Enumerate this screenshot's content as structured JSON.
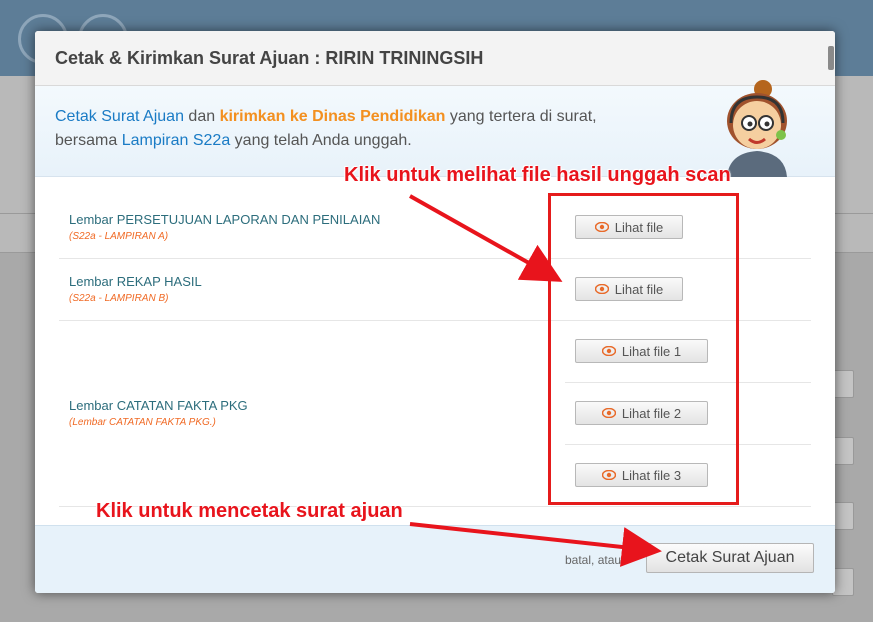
{
  "modal": {
    "title": "Cetak & Kirimkan Surat Ajuan : RIRIN TRININGSIH",
    "intro": {
      "part1": "Cetak Surat Ajuan",
      "part2": " dan ",
      "part3": "kirimkan ke Dinas Pendidikan",
      "part4": " yang tertera di surat,",
      "part5": "bersama ",
      "part6": "Lampiran S22a",
      "part7": " yang telah Anda unggah."
    },
    "rows": [
      {
        "label": "Lembar PERSETUJUAN LAPORAN DAN PENILAIAN",
        "sub": "(S22a - LAMPIRAN A)",
        "buttons": [
          "Lihat file"
        ]
      },
      {
        "label": "Lembar REKAP HASIL",
        "sub": "(S22a - LAMPIRAN B)",
        "buttons": [
          "Lihat file"
        ]
      },
      {
        "label": "Lembar CATATAN FAKTA PKG",
        "sub": "(Lembar CATATAN FAKTA PKG.)",
        "buttons": [
          "Lihat file 1",
          "Lihat file 2",
          "Lihat file 3"
        ]
      }
    ],
    "footer": {
      "cancel_text": "batal, atau",
      "print_label": "Cetak Surat Ajuan"
    }
  },
  "annotations": {
    "view_files": "Klik untuk melihat file hasil unggah scan",
    "print_letter": "Klik untuk mencetak surat ajuan"
  },
  "colors": {
    "accent_blue": "#1a7bc5",
    "accent_orange": "#f39020",
    "annotation_red": "#e8141c"
  },
  "icons": {
    "file_button": "eye-icon"
  }
}
